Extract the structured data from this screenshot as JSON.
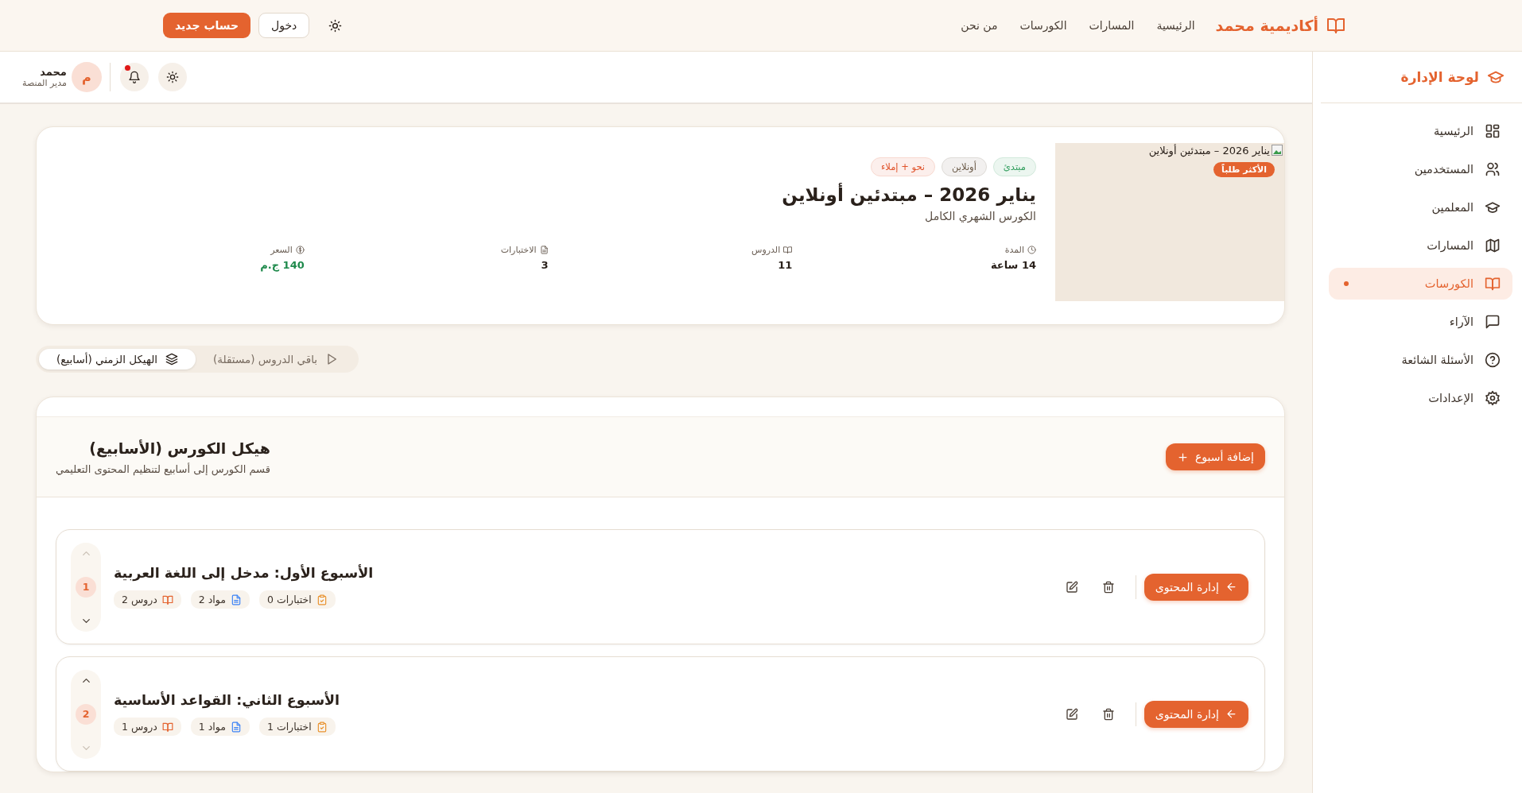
{
  "topnav": {
    "brand": "أكاديمية محمد",
    "links": [
      "الرئيسية",
      "المسارات",
      "الكورسات",
      "من نحن"
    ],
    "login": "دخول",
    "signup": "حساب جديد"
  },
  "admin_header": {
    "user_name": "محمد",
    "user_role": "مدير المنصة",
    "avatar": "م",
    "has_notification": true
  },
  "sidebar": {
    "title": "لوحة الإدارة",
    "items": [
      {
        "label": "الرئيسية",
        "kind": "grid",
        "selected": false
      },
      {
        "label": "المستخدمين",
        "kind": "users",
        "selected": false
      },
      {
        "label": "المعلمين",
        "kind": "cap",
        "selected": false
      },
      {
        "label": "المسارات",
        "kind": "map",
        "selected": false
      },
      {
        "label": "الكورسات",
        "kind": "book",
        "selected": true
      },
      {
        "label": "الآراء",
        "kind": "message",
        "selected": false
      },
      {
        "label": "الأسئلة الشائعة",
        "kind": "help",
        "selected": false
      },
      {
        "label": "الإعدادات",
        "kind": "gear",
        "selected": false
      }
    ]
  },
  "course": {
    "image_alt": "يناير 2026 – مبتدئين أونلاين",
    "badge": "الأكثر طلباً",
    "tags": [
      {
        "label": "مبتدئ",
        "color": "#2f9d5c"
      },
      {
        "label": "أونلاين",
        "color": "#6b5a48"
      },
      {
        "label": "نحو + إملاء",
        "color": "#e0522a"
      }
    ],
    "title": "يناير 2026 – مبتدئين أونلاين",
    "subtitle": "الكورس الشهري الكامل",
    "stats": [
      {
        "kind": "clock",
        "label": "المدة",
        "value": "14 ساعة",
        "highlight": false
      },
      {
        "kind": "book",
        "label": "الدروس",
        "value": "11",
        "highlight": false
      },
      {
        "kind": "file",
        "label": "الاختبارات",
        "value": "3",
        "highlight": false
      },
      {
        "kind": "dollar",
        "label": "السعر",
        "value": "140 ج.م",
        "highlight": true
      }
    ]
  },
  "tabs": [
    {
      "label": "باقي الدروس (مستقلة)",
      "kind": "play",
      "selected": false
    },
    {
      "label": "الهيكل الزمني (أسابيع)",
      "kind": "layers",
      "selected": true
    }
  ],
  "structure": {
    "title": "هيكل الكورس (الأسابيع)",
    "subtitle": "قسم الكورس إلى أسابيع لتنظيم المحتوى التعليمي",
    "add_button": "إضافة أسبوع",
    "weeks": [
      {
        "number": "1",
        "title": "الأسبوع الأول: مدخل إلى اللغة العربية",
        "up_disabled": true,
        "down_disabled": false,
        "manage": "إدارة المحتوى",
        "chips": [
          {
            "kind": "quizzes",
            "label": "اختبارات 0"
          },
          {
            "kind": "materials",
            "label": "مواد 2"
          },
          {
            "kind": "lessons",
            "label": "دروس 2"
          }
        ]
      },
      {
        "number": "2",
        "title": "الأسبوع الثاني: القواعد الأساسية",
        "up_disabled": false,
        "down_disabled": true,
        "manage": "إدارة المحتوى",
        "chips": [
          {
            "kind": "quizzes",
            "label": "اختبارات 1"
          },
          {
            "kind": "materials",
            "label": "مواد 1"
          },
          {
            "kind": "lessons",
            "label": "دروس 1"
          }
        ]
      }
    ]
  }
}
